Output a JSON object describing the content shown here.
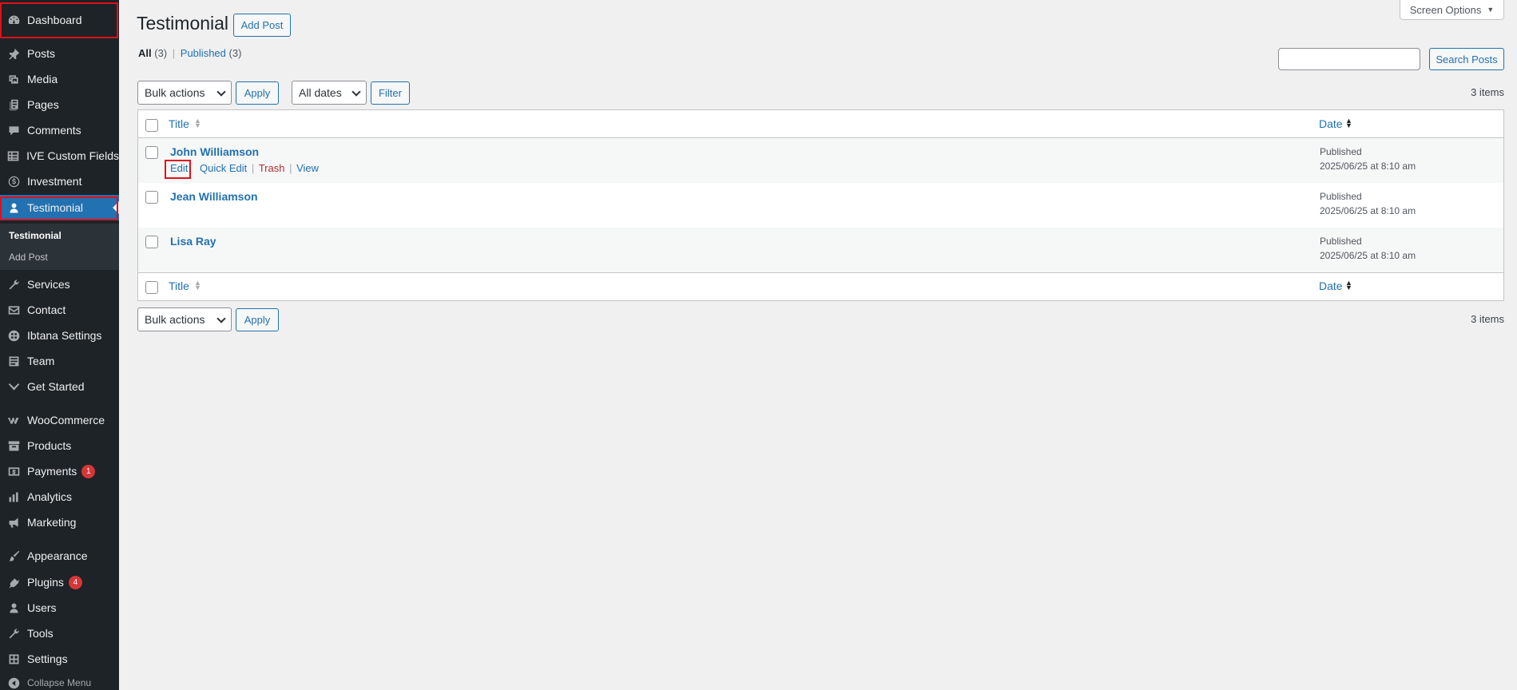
{
  "sidebar": {
    "items": [
      {
        "label": "Dashboard",
        "icon": "dashboard-icon"
      },
      {
        "label": "Posts",
        "icon": "pin-icon"
      },
      {
        "label": "Media",
        "icon": "media-icon"
      },
      {
        "label": "Pages",
        "icon": "pages-icon"
      },
      {
        "label": "Comments",
        "icon": "comments-icon"
      },
      {
        "label": "IVE Custom Fields",
        "icon": "grid-icon"
      },
      {
        "label": "Investment",
        "icon": "dollar-icon"
      },
      {
        "label": "Testimonial",
        "icon": "user-icon"
      },
      {
        "label": "Services",
        "icon": "wrench-icon"
      },
      {
        "label": "Contact",
        "icon": "mail-icon"
      },
      {
        "label": "Ibtana Settings",
        "icon": "ibtana-icon"
      },
      {
        "label": "Team",
        "icon": "team-icon"
      },
      {
        "label": "Get Started",
        "icon": "chevron-icon"
      },
      {
        "label": "WooCommerce",
        "icon": "woo-icon"
      },
      {
        "label": "Products",
        "icon": "archive-icon"
      },
      {
        "label": "Payments",
        "icon": "payment-icon",
        "badge": "1"
      },
      {
        "label": "Analytics",
        "icon": "chart-icon"
      },
      {
        "label": "Marketing",
        "icon": "megaphone-icon"
      },
      {
        "label": "Appearance",
        "icon": "brush-icon"
      },
      {
        "label": "Plugins",
        "icon": "plug-icon",
        "badge": "4"
      },
      {
        "label": "Users",
        "icon": "users-icon"
      },
      {
        "label": "Tools",
        "icon": "tools-icon"
      },
      {
        "label": "Settings",
        "icon": "settings-icon"
      },
      {
        "label": "Collapse Menu",
        "icon": "collapse-icon"
      }
    ],
    "submenu": {
      "current": "Testimonial",
      "add": "Add Post"
    }
  },
  "header": {
    "title": "Testimonial",
    "add_post": "Add Post",
    "screen_options": "Screen Options"
  },
  "filters": {
    "all_label": "All",
    "all_count": "(3)",
    "separator": "|",
    "published_label": "Published",
    "published_count": "(3)"
  },
  "search": {
    "button": "Search Posts",
    "value": ""
  },
  "tablenav": {
    "bulk_actions": "Bulk actions",
    "apply": "Apply",
    "all_dates": "All dates",
    "filter": "Filter",
    "items_count": "3 items"
  },
  "table": {
    "columns": {
      "title": "Title",
      "date": "Date"
    },
    "rows": [
      {
        "title": "John Williamson",
        "status": "Published",
        "date": "2025/06/25 at 8:10 am"
      },
      {
        "title": "Jean Williamson",
        "status": "Published",
        "date": "2025/06/25 at 8:10 am"
      },
      {
        "title": "Lisa Ray",
        "status": "Published",
        "date": "2025/06/25 at 8:10 am"
      }
    ],
    "row_actions": {
      "edit": "Edit",
      "quick_edit": "Quick Edit",
      "trash": "Trash",
      "view": "View",
      "sep": "|"
    }
  },
  "colors": {
    "sidebar_bg": "#1d2327",
    "accent": "#2271b1",
    "highlight_box": "#e0101a",
    "badge": "#d63638",
    "trash": "#b32d2e"
  }
}
